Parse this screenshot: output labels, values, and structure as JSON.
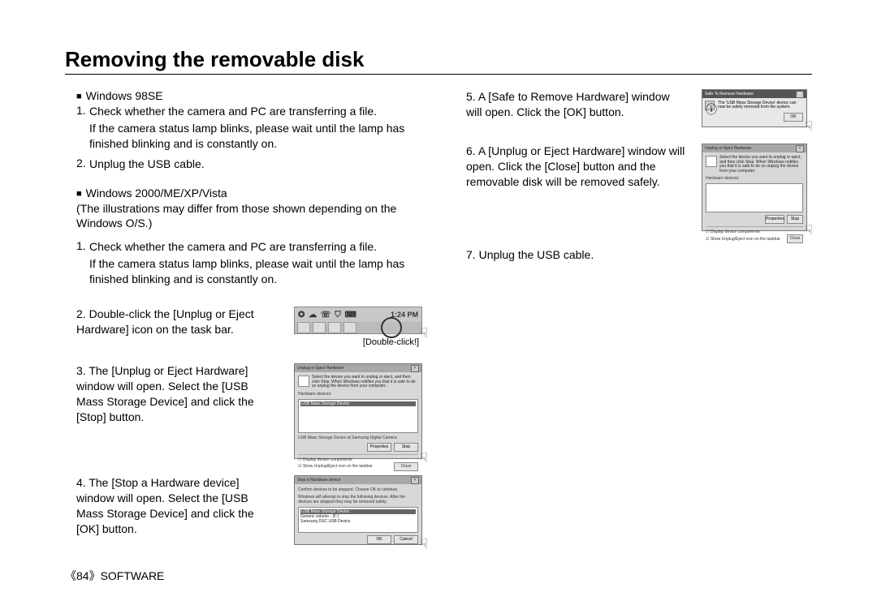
{
  "title": "Removing the removable disk",
  "left": {
    "heading1": "Windows 98SE",
    "h1_steps": [
      {
        "num": "1.",
        "text": "Check whether the camera and PC are transferring a file."
      },
      {
        "indent": "If the camera status lamp blinks, please wait until the lamp has finished blinking and is constantly on."
      },
      {
        "num": "2.",
        "text": "Unplug the USB cable."
      }
    ],
    "heading2": "Windows 2000/ME/XP/Vista",
    "h2_note": "(The illustrations may differ from those shown depending on  the Windows O/S.)",
    "h2_step1": {
      "num": "1.",
      "text": "Check whether the camera and PC are transferring a file."
    },
    "h2_step1_indent": "If the camera status lamp blinks, please wait until the lamp has finished blinking and is constantly on.",
    "h2_step2": {
      "num": "2.",
      "text": "Double-click the [Unplug or Eject Hardware] icon on the task bar."
    },
    "h2_step2_time": "1:24 PM",
    "h2_step2_caption": "[Double-click!]",
    "h2_step3": {
      "num": "3.",
      "text": "The [Unplug or Eject Hardware] window will open. Select the [USB Mass Storage Device] and click the [Stop] button."
    },
    "dlg3": {
      "title": "Unplug or Eject Hardware",
      "info": "Select the device you want to unplug or eject, and then click Stop. When Windows notifies you that it is safe to do so unplug the device from your computer.",
      "label": "Hardware devices:",
      "item": "USB Mass Storage Device",
      "caption": "USB Mass Storage Device at Samsung Digital Camera",
      "btn1": "Properties",
      "btn2": "Stop",
      "check1": "Display device components",
      "check2": "Show Unplug/Eject icon on the taskbar",
      "close": "Close"
    },
    "h2_step4": {
      "num": "4.",
      "text": "The [Stop a Hardware device] window will open. Select the [USB Mass Storage Device] and click the [OK] button."
    },
    "dlg4": {
      "title": "Stop a Hardware device",
      "info": "Confirm devices to be stopped. Choose OK to continue.",
      "sub": "Windows will attempt to stop the following devices. After the devices are stopped they may be removed safely.",
      "item1": "USB Mass Storage Device",
      "item2": "Generic volume - (F:)",
      "item3": "Samsung DSC USB Device",
      "ok": "OK",
      "cancel": "Cancel"
    }
  },
  "right": {
    "step5": {
      "num": "5.",
      "text": "A [Safe to Remove Hardware] window will open. Click the [OK] button."
    },
    "tt5": {
      "title": "Safe To Remove Hardware",
      "text": "The 'USB Mass Storage Device' device can now be safely removed from the system.",
      "ok": "OK"
    },
    "step6": {
      "num": "6.",
      "text": "A [Unplug or Eject Hardware] window will open. Click the [Close] button and the removable disk will be removed safely."
    },
    "dlg6": {
      "title": "Unplug or Eject Hardware",
      "info": "Select the device you want to unplug or eject, and then click Stop. When Windows notifies you that it is safe to do so unplug the device from your computer.",
      "label": "Hardware devices:",
      "btn1": "Properties",
      "btn2": "Stop",
      "check1": "Display device components",
      "check2": "Show Unplug/Eject icon on the taskbar",
      "close": "Close"
    },
    "step7": {
      "num": "7.",
      "text": "Unplug the USB cable."
    }
  },
  "footer": {
    "page": "《84》",
    "section": "SOFTWARE"
  }
}
